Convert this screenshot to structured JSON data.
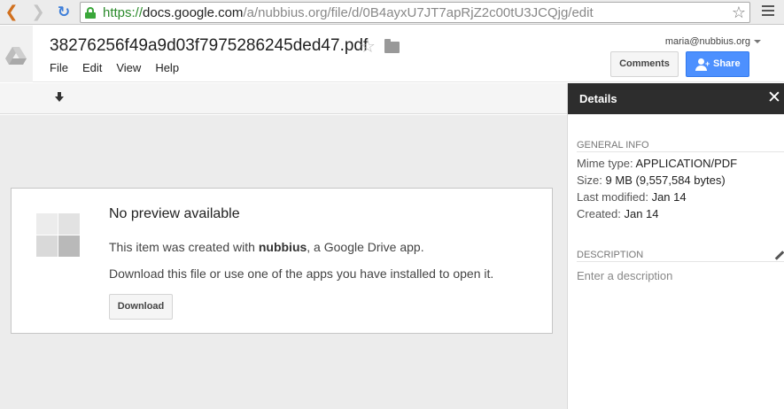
{
  "browser": {
    "url_scheme": "https://",
    "url_domain": "docs.google.com",
    "url_path": "/a/nubbius.org/file/d/0B4ayxU7JT7apRjZ2c00tU3JCQjg/edit"
  },
  "header": {
    "file_title": "38276256f49a9d03f7975286245ded47.pdf",
    "menus": [
      "File",
      "Edit",
      "View",
      "Help"
    ],
    "account": "maria@nubbius.org",
    "comments_label": "Comments",
    "share_label": "Share"
  },
  "preview": {
    "title": "No preview available",
    "line1_prefix": "This item was created with ",
    "line1_app": "nubbius",
    "line1_suffix": ", a Google Drive app.",
    "line2": "Download this file or use one of the apps you have installed to open it.",
    "download_label": "Download"
  },
  "details": {
    "title": "Details",
    "general_head": "GENERAL INFO",
    "rows": [
      {
        "key": "Mime type",
        "value": "APPLICATION/PDF"
      },
      {
        "key": "Size",
        "value": "9 MB (9,557,584 bytes)"
      },
      {
        "key": "Last modified",
        "value": "Jan 14"
      },
      {
        "key": "Created",
        "value": "Jan 14"
      }
    ],
    "description_head": "DESCRIPTION",
    "description_placeholder": "Enter a description"
  },
  "colors": {
    "share_blue": "#4d90fe",
    "details_header": "#2d2d2d",
    "secure_green": "#2a8a2a"
  }
}
